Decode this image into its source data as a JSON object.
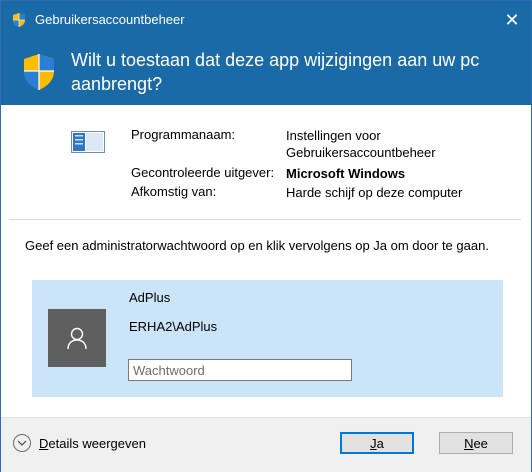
{
  "window": {
    "title": "Gebruikersaccountbeheer",
    "close_glyph": "✕"
  },
  "banner": {
    "question": "Wilt u toestaan dat deze app wijzigingen aan uw pc aanbrengt?"
  },
  "app_info": {
    "program_label": "Programmanaam:",
    "program_value": "Instellingen voor Gebruikersaccountbeheer",
    "publisher_label": "Gecontroleerde uitgever:",
    "publisher_value": "Microsoft Windows",
    "origin_label": "Afkomstig van:",
    "origin_value": "Harde schijf op deze computer"
  },
  "prompt": {
    "text": "Geef een administratorwachtwoord op en klik vervolgens op Ja om door te gaan."
  },
  "credentials": {
    "user_name": "AdPlus",
    "user_domain": "ERHA2\\AdPlus",
    "password_placeholder": "Wachtwoord",
    "password_value": ""
  },
  "footer": {
    "details_first": "D",
    "details_rest": "etails weergeven",
    "yes_first": "J",
    "yes_rest": "a",
    "no_first": "N",
    "no_rest": "ee"
  },
  "colors": {
    "accent": "#1a6aa8",
    "panel": "#cce4f7",
    "avatar": "#5f5f5f",
    "focus": "#0078d7"
  }
}
